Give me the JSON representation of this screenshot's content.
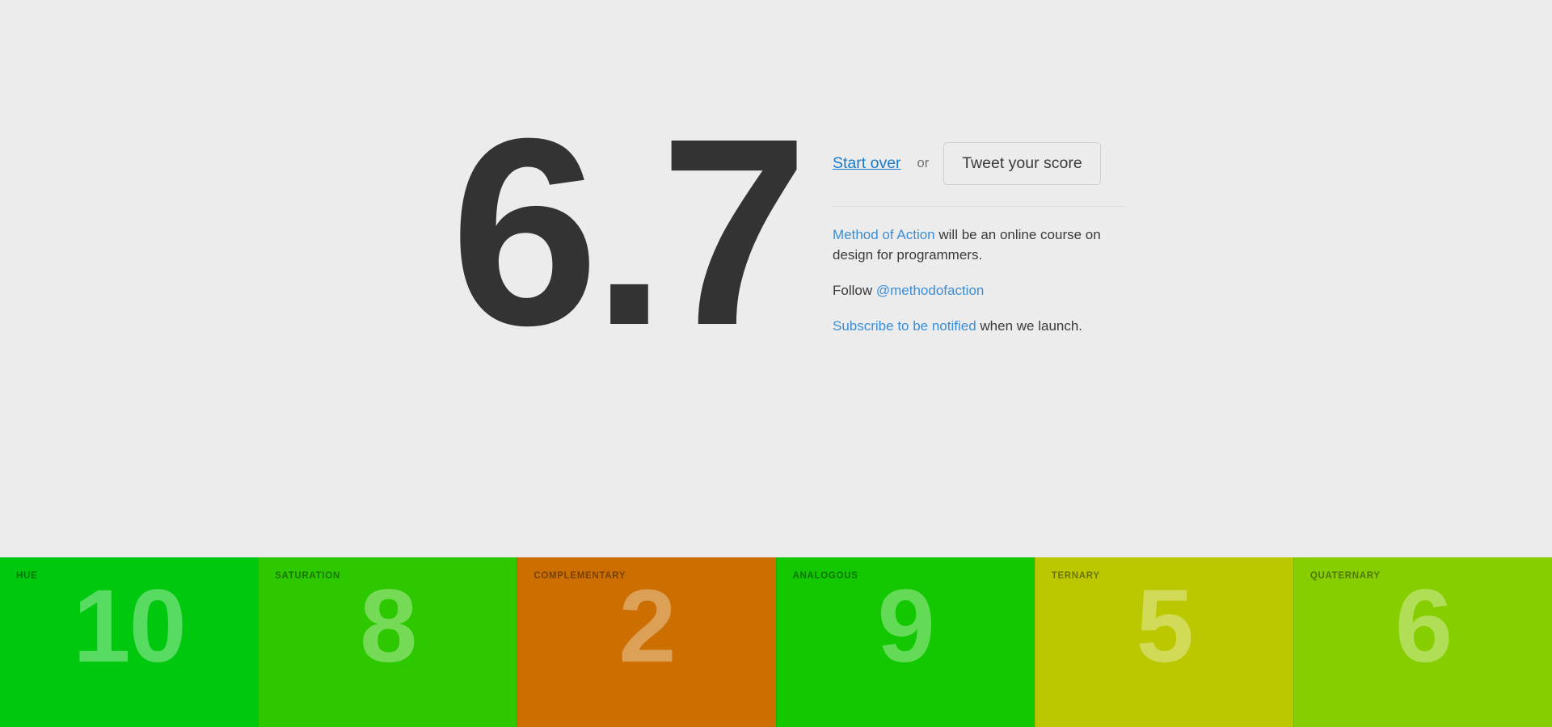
{
  "page": {
    "background_color": "#ececec",
    "text_color": "#333333"
  },
  "score": {
    "total": "6.7"
  },
  "actions": {
    "start_over_label": "Start over",
    "or_label": "or",
    "tweet_label": "Tweet your score"
  },
  "about": {
    "line1_link": "Method of Action",
    "line1_rest": " will be an online course on design for programmers.",
    "line2_prefix": "Follow ",
    "line2_link": "@methodofaction",
    "line3_link": "Subscribe to be notified",
    "line3_rest": " when we launch."
  },
  "score_bars": [
    {
      "label": "HUE",
      "value": "10",
      "color": "#00c80f"
    },
    {
      "label": "SATURATION",
      "value": "8",
      "color": "#2ec800"
    },
    {
      "label": "COMPLEMENTARY",
      "value": "2",
      "color": "#cc6f00"
    },
    {
      "label": "ANALOGOUS",
      "value": "9",
      "color": "#13c800"
    },
    {
      "label": "TERNARY",
      "value": "5",
      "color": "#bbc800"
    },
    {
      "label": "QUATERNARY",
      "value": "6",
      "color": "#87ce00"
    }
  ]
}
